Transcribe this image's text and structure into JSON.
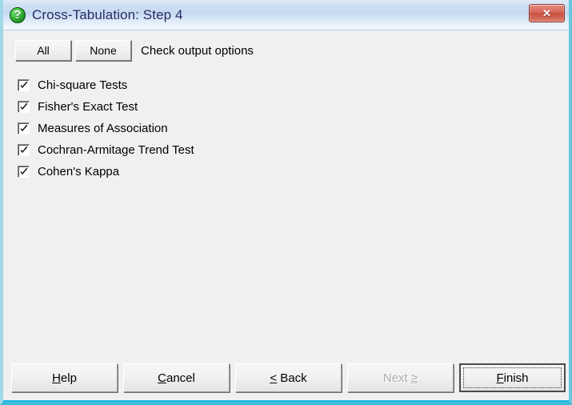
{
  "window": {
    "title": "Cross-Tabulation: Step 4",
    "icon": "green-question-sphere-icon",
    "close_label": "✕",
    "frame_color": "#3dbcdc",
    "titlebar_text_color": "#2b2b63",
    "client_background": "#f0f0f0"
  },
  "toolbar": {
    "all_label": "All",
    "none_label": "None",
    "instruction_label": "Check output options"
  },
  "options": [
    {
      "label": "Chi-square Tests",
      "checked": true
    },
    {
      "label": "Fisher's Exact Test",
      "checked": true
    },
    {
      "label": "Measures of Association",
      "checked": true
    },
    {
      "label": "Cochran-Armitage Trend Test",
      "checked": true
    },
    {
      "label": "Cohen's Kappa",
      "checked": true
    }
  ],
  "buttons": {
    "help": {
      "label": "Help",
      "accel": "H",
      "enabled": true,
      "default": false
    },
    "cancel": {
      "label": "Cancel",
      "accel": "C",
      "enabled": true,
      "default": false
    },
    "back": {
      "label": "< Back",
      "accel": "<",
      "enabled": true,
      "default": false
    },
    "next": {
      "label": "Next ≥",
      "accel": "≥",
      "enabled": false,
      "default": false
    },
    "finish": {
      "label": "Finish",
      "accel": "F",
      "enabled": true,
      "default": true
    }
  }
}
